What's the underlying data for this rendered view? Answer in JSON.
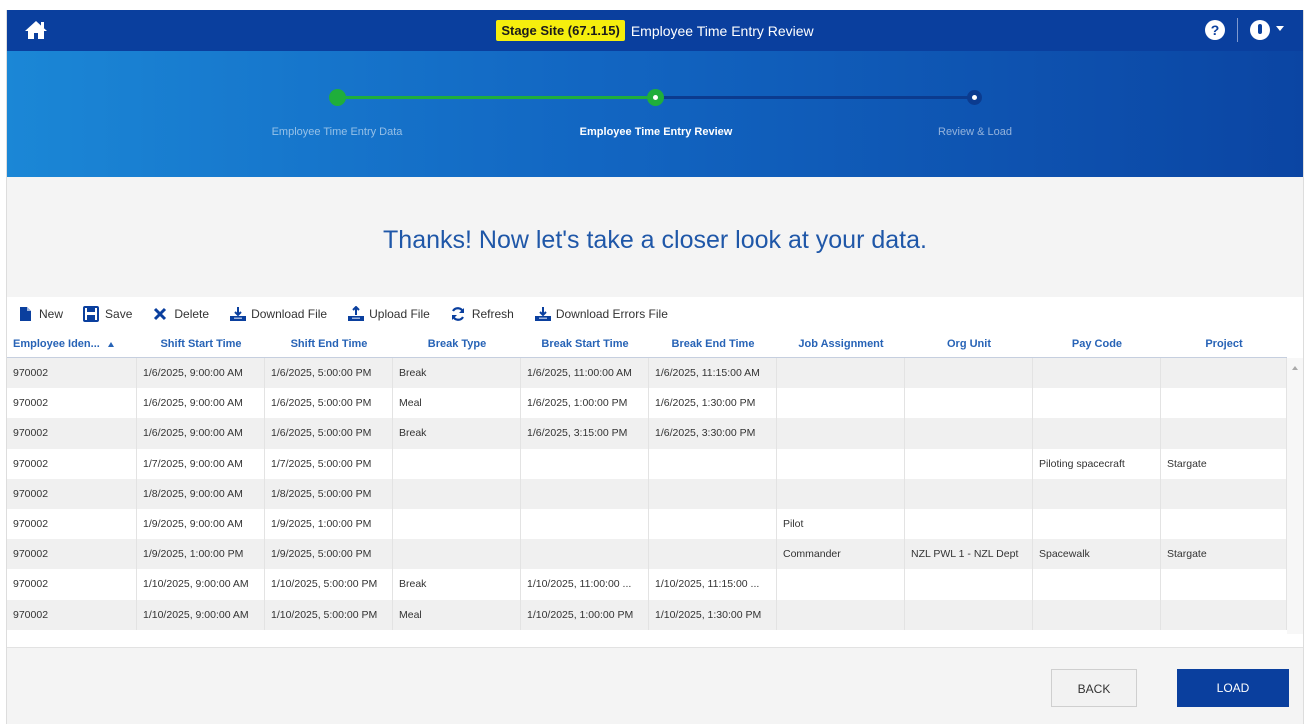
{
  "header": {
    "stage_badge": "Stage Site (67.1.15)",
    "title": "Employee Time Entry Review"
  },
  "steps": [
    {
      "label": "Employee Time Entry Data",
      "state": "completed"
    },
    {
      "label": "Employee Time Entry Review",
      "state": "current"
    },
    {
      "label": "Review & Load",
      "state": "upcoming"
    }
  ],
  "heading": "Thanks! Now let's take a closer look at your data.",
  "toolbar": {
    "new": "New",
    "save": "Save",
    "delete": "Delete",
    "download_file": "Download File",
    "upload_file": "Upload File",
    "refresh": "Refresh",
    "download_errors": "Download Errors File"
  },
  "columns": [
    "Employee Iden...",
    "Shift Start Time",
    "Shift End Time",
    "Break Type",
    "Break Start Time",
    "Break End Time",
    "Job Assignment",
    "Org Unit",
    "Pay Code",
    "Project"
  ],
  "rows": [
    [
      "970002",
      "1/6/2025, 9:00:00 AM",
      "1/6/2025, 5:00:00 PM",
      "Break",
      "1/6/2025, 11:00:00 AM",
      "1/6/2025, 11:15:00 AM",
      "",
      "",
      "",
      ""
    ],
    [
      "970002",
      "1/6/2025, 9:00:00 AM",
      "1/6/2025, 5:00:00 PM",
      "Meal",
      "1/6/2025, 1:00:00 PM",
      "1/6/2025, 1:30:00 PM",
      "",
      "",
      "",
      ""
    ],
    [
      "970002",
      "1/6/2025, 9:00:00 AM",
      "1/6/2025, 5:00:00 PM",
      "Break",
      "1/6/2025, 3:15:00 PM",
      "1/6/2025, 3:30:00 PM",
      "",
      "",
      "",
      ""
    ],
    [
      "970002",
      "1/7/2025, 9:00:00 AM",
      "1/7/2025, 5:00:00 PM",
      "",
      "",
      "",
      "",
      "",
      "Piloting spacecraft",
      "Stargate"
    ],
    [
      "970002",
      "1/8/2025, 9:00:00 AM",
      "1/8/2025, 5:00:00 PM",
      "",
      "",
      "",
      "",
      "",
      "",
      ""
    ],
    [
      "970002",
      "1/9/2025, 9:00:00 AM",
      "1/9/2025, 1:00:00 PM",
      "",
      "",
      "",
      "Pilot",
      "",
      "",
      ""
    ],
    [
      "970002",
      "1/9/2025, 1:00:00 PM",
      "1/9/2025, 5:00:00 PM",
      "",
      "",
      "",
      "Commander",
      "NZL PWL 1 - NZL Dept",
      "Spacewalk",
      "Stargate"
    ],
    [
      "970002",
      "1/10/2025, 9:00:00 AM",
      "1/10/2025, 5:00:00 PM",
      "Break",
      "1/10/2025, 11:00:00 ...",
      "1/10/2025, 11:15:00 ...",
      "",
      "",
      "",
      ""
    ],
    [
      "970002",
      "1/10/2025, 9:00:00 AM",
      "1/10/2025, 5:00:00 PM",
      "Meal",
      "1/10/2025, 1:00:00 PM",
      "1/10/2025, 1:30:00 PM",
      "",
      "",
      "",
      ""
    ]
  ],
  "buttons": {
    "back": "BACK",
    "load": "LOAD"
  },
  "colors": {
    "header_bg": "#0a3f9e",
    "stage_badge_bg": "#f5ee0d",
    "completed_step": "#1fae3b",
    "heading_text": "#1f57a8",
    "column_header_text": "#2763b6",
    "load_button": "#0a3f9e"
  },
  "icons": {
    "home": "home-icon",
    "help": "help-icon",
    "user": "user-icon",
    "new": "new-document-icon",
    "save": "floppy-disk-icon",
    "delete": "x-icon",
    "download": "tray-download-icon",
    "upload": "tray-upload-icon",
    "refresh": "refresh-icon"
  }
}
